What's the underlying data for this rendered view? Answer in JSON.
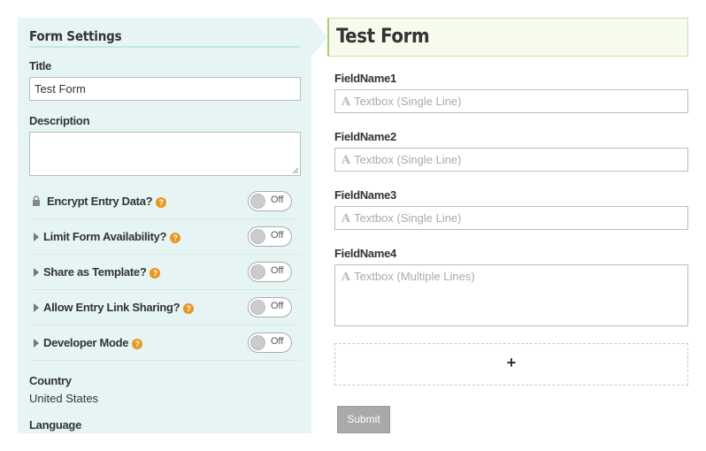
{
  "settings": {
    "heading": "Form Settings",
    "title_label": "Title",
    "title_value": "Test Form",
    "description_label": "Description",
    "description_value": "",
    "options": [
      {
        "label": "Encrypt Entry Data?",
        "help": "?",
        "state": "Off",
        "icon": "lock-icon"
      },
      {
        "label": "Limit Form Availability?",
        "help": "?",
        "state": "Off",
        "icon": "caret-right-icon"
      },
      {
        "label": "Share as Template?",
        "help": "?",
        "state": "Off",
        "icon": "caret-right-icon"
      },
      {
        "label": "Allow Entry Link Sharing?",
        "help": "?",
        "state": "Off",
        "icon": "caret-right-icon"
      },
      {
        "label": "Developer Mode",
        "help": "?",
        "state": "Off",
        "icon": "caret-right-icon"
      }
    ],
    "country_label": "Country",
    "country_value": "United States",
    "language_label": "Language"
  },
  "form": {
    "title": "Test Form",
    "fields": [
      {
        "label": "FieldName1",
        "placeholder": "Textbox (Single Line)",
        "icon_glyph": "A"
      },
      {
        "label": "FieldName2",
        "placeholder": "Textbox (Single Line)",
        "icon_glyph": "A"
      },
      {
        "label": "FieldName3",
        "placeholder": "Textbox (Single Line)",
        "icon_glyph": "A"
      },
      {
        "label": "FieldName4",
        "placeholder": "Textbox (Multiple Lines)",
        "icon_glyph": "A"
      }
    ],
    "add_glyph": "+",
    "submit_label": "Submit"
  },
  "colors": {
    "settings_bg": "#e6f5f3",
    "header_bg": "#f6fbee",
    "help_badge": "#e8961f",
    "submit_bg": "#a9a9a9"
  }
}
